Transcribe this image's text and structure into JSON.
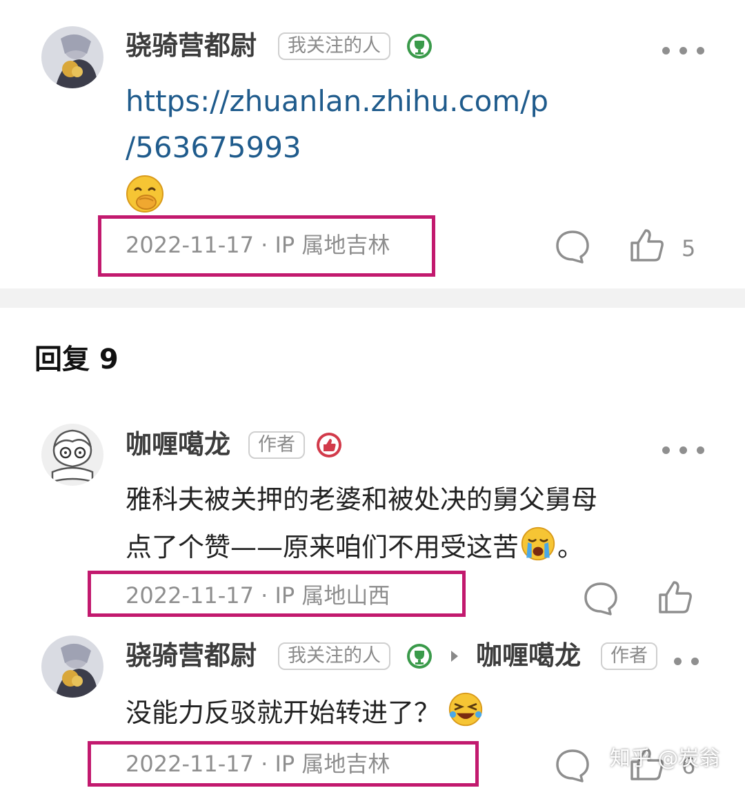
{
  "colors": {
    "link": "#1f5b8c",
    "highlight_box": "#c2196e",
    "meta_text": "#8e8e8e",
    "badge_green": "#3a9a4a",
    "badge_red": "#d23a4a"
  },
  "comment1": {
    "username": "骁骑营都尉",
    "tag": "我关注的人",
    "badge_icon": "trophy-badge-icon",
    "link_line1": "https://zhuanlan.zhihu.com/p",
    "link_line2": "/563675993",
    "emoji": "giggle-emoji",
    "meta": "2022-11-17 · IP 属地吉林",
    "like_count": "5"
  },
  "replies_header": "回复 9",
  "reply1": {
    "username": "咖喱噶龙",
    "tag": "作者",
    "badge_icon": "thumb-badge-icon",
    "line1": "雅科夫被关押的老婆和被处决的舅父舅母",
    "line2_before": "点了个赞——原来咱们不用受这苦",
    "line2_after": "。",
    "emoji": "crying-emoji",
    "meta": "2022-11-17 · IP 属地山西"
  },
  "reply2": {
    "username": "骁骑营都尉",
    "tag": "我关注的人",
    "badge_icon": "trophy-badge-icon",
    "reply_to_username": "咖喱噶龙",
    "reply_to_tag": "作者",
    "text": "没能力反驳就开始转进了？",
    "emoji": "laughing-emoji",
    "meta": "2022-11-17 · IP 属地吉林",
    "like_count": "6"
  },
  "watermark": "知乎 @炭翁"
}
